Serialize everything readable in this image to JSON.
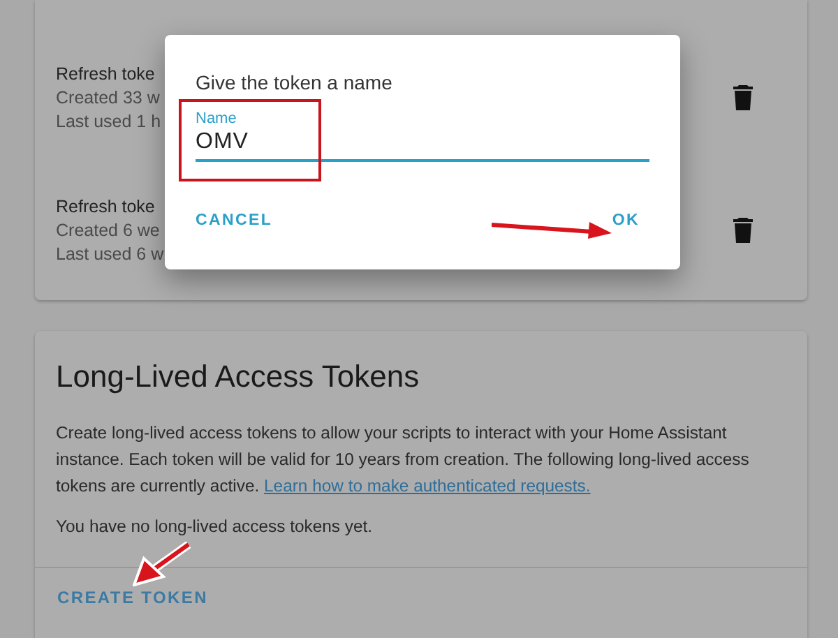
{
  "token_list": {
    "items": [
      {
        "title": "Refresh toke",
        "created": "Created 33 w",
        "last_used": "Last used 1 h"
      },
      {
        "title": "Refresh toke",
        "created": "Created 6 we",
        "last_used": "Last used 6 w"
      }
    ]
  },
  "long_lived_tokens": {
    "title": "Long-Lived Access Tokens",
    "description": "Create long-lived access tokens to allow your scripts to interact with your Home Assistant instance. Each token will be valid for 10 years from creation. The following long-lived access tokens are currently active.",
    "link": "Learn how to make authenticated requests.",
    "empty_message": "You have no long-lived access tokens yet.",
    "create_button": "CREATE TOKEN"
  },
  "dialog": {
    "title": "Give the token a name",
    "field": {
      "label": "Name",
      "value": "OMV"
    },
    "buttons": [
      {
        "label": "CANCEL"
      },
      {
        "label": "OK"
      }
    ]
  }
}
